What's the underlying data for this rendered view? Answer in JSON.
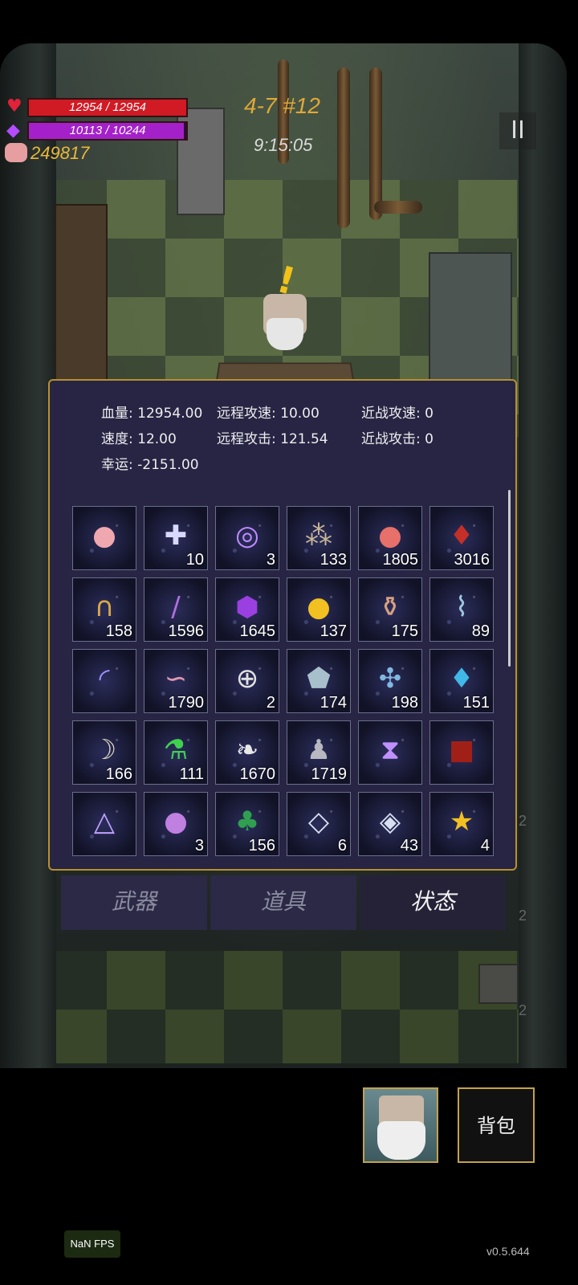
{
  "hud": {
    "hp_text": "12954 / 12954",
    "hp_fraction": 1.0,
    "mp_text": "10113 / 10244",
    "mp_fraction": 0.987,
    "coins": "249817",
    "level": "4-7 #12",
    "timer": "9:15:05",
    "pause_label": "II",
    "colors": {
      "hp": "#d01a24",
      "mp": "#a421c9",
      "gold": "#e9b93a"
    }
  },
  "stats": [
    {
      "label": "血量:",
      "value": "12954.00"
    },
    {
      "label": "远程攻速:",
      "value": "10.00"
    },
    {
      "label": "近战攻速:",
      "value": "0"
    },
    {
      "label": "速度:",
      "value": "12.00"
    },
    {
      "label": "远程攻击:",
      "value": "121.54"
    },
    {
      "label": "近战攻击:",
      "value": "0"
    },
    {
      "label": "幸运:",
      "value": "-2151.00"
    }
  ],
  "items": [
    {
      "icon": "piggy-bank-icon",
      "count": ""
    },
    {
      "icon": "medkit-icon",
      "count": "10"
    },
    {
      "icon": "spiral-rune-icon",
      "count": "3"
    },
    {
      "icon": "pebbles-icon",
      "count": "133"
    },
    {
      "icon": "peach-icon",
      "count": "1805"
    },
    {
      "icon": "treasure-bag-icon",
      "count": "3016"
    },
    {
      "icon": "horseshoe-icon",
      "count": "158"
    },
    {
      "icon": "wand-icon",
      "count": "1596"
    },
    {
      "icon": "purple-snail-icon",
      "count": "1645"
    },
    {
      "icon": "gold-coin-icon",
      "count": "137"
    },
    {
      "icon": "vase-icon",
      "count": "175"
    },
    {
      "icon": "vial-icon",
      "count": "89"
    },
    {
      "icon": "curve-rune-icon",
      "count": ""
    },
    {
      "icon": "worm-icon",
      "count": "1790"
    },
    {
      "icon": "medal-icon",
      "count": "2"
    },
    {
      "icon": "stone-icon",
      "count": "174"
    },
    {
      "icon": "dragonfly-icon",
      "count": "198"
    },
    {
      "icon": "crystal-icon",
      "count": "151"
    },
    {
      "icon": "horn-icon",
      "count": "166"
    },
    {
      "icon": "green-potion-icon",
      "count": "111"
    },
    {
      "icon": "feather-icon",
      "count": "1670"
    },
    {
      "icon": "statue-icon",
      "count": "1719"
    },
    {
      "icon": "hourglass-rune-icon",
      "count": ""
    },
    {
      "icon": "spellbook-icon",
      "count": ""
    },
    {
      "icon": "triangle-rune-icon",
      "count": ""
    },
    {
      "icon": "slime-icon",
      "count": "3"
    },
    {
      "icon": "clover-icon",
      "count": "156"
    },
    {
      "icon": "chevron-gem-icon",
      "count": "6"
    },
    {
      "icon": "stacked-gem-icon",
      "count": "43"
    },
    {
      "icon": "star-trophy-icon",
      "count": "4"
    }
  ],
  "tabs": {
    "weapons": "武器",
    "props": "道具",
    "status": "状态"
  },
  "bottom": {
    "bag_label": "背包",
    "fps": "NaN FPS",
    "version": "v0.5.644"
  },
  "side_counts": [
    "2",
    "2",
    "2"
  ]
}
